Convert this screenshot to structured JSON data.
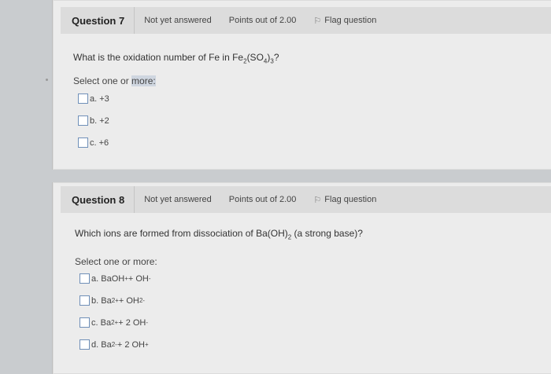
{
  "q7": {
    "title": "Question 7",
    "state": "Not yet answered",
    "points": "Points out of 2.00",
    "flag_label": "Flag question",
    "question_prefix": "What is the oxidation number of Fe in Fe",
    "sub1": "2",
    "mid": "(SO",
    "sub2": "4",
    "close": ")",
    "sub3": "3",
    "question_suffix": "?",
    "instruction": "Select one or more:",
    "options": [
      {
        "letter": "a.",
        "text": "+3"
      },
      {
        "letter": "b.",
        "text": "+2"
      },
      {
        "letter": "c.",
        "text": "+6"
      }
    ]
  },
  "q8": {
    "title": "Question 8",
    "state": "Not yet answered",
    "points": "Points out of 2.00",
    "flag_label": "Flag question",
    "question_prefix": "Which ions are formed from dissociation of Ba(OH)",
    "sub1": "2",
    "question_suffix": " (a strong base)?",
    "instruction": "Select one or more:",
    "options": [
      {
        "letter": "a.",
        "parts": [
          "BaOH",
          "+",
          " + OH",
          "-",
          ""
        ]
      },
      {
        "letter": "b.",
        "parts": [
          "Ba",
          "2+",
          " + OH",
          "2-",
          ""
        ]
      },
      {
        "letter": "c.",
        "parts": [
          "Ba",
          "2+",
          " + 2 OH",
          "-",
          ""
        ]
      },
      {
        "letter": "d.",
        "parts": [
          "Ba",
          "2-",
          " + 2 OH",
          "+",
          ""
        ]
      }
    ]
  }
}
